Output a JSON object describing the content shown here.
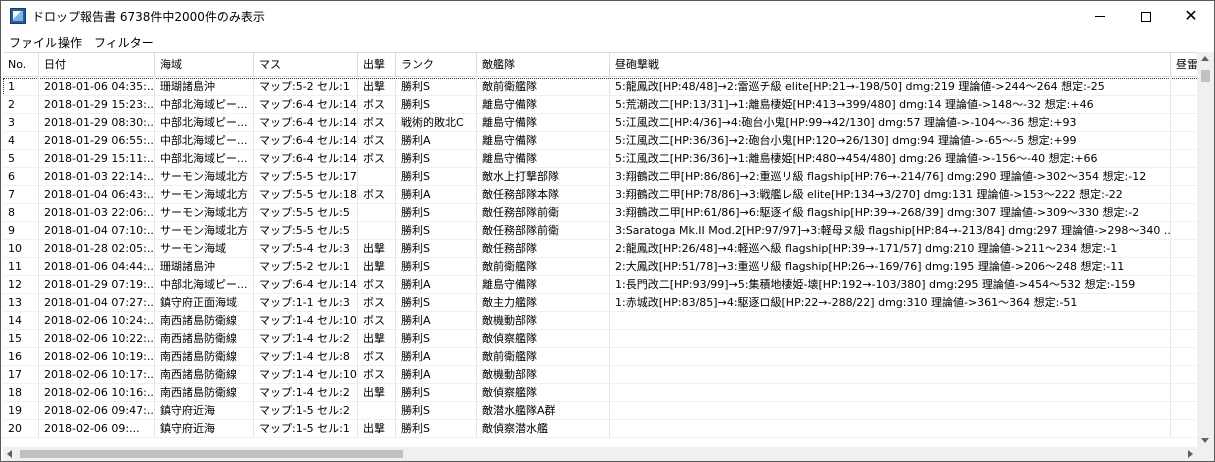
{
  "window": {
    "title": "ドロップ報告書 6738件中2000件のみ表示",
    "minimize_icon": "minimize-icon",
    "maximize_icon": "maximize-icon",
    "close_icon": "close-icon"
  },
  "menu": {
    "items": [
      "ファイル",
      "操作",
      "フィルター"
    ]
  },
  "table": {
    "columns": [
      "No.",
      "日付",
      "海域",
      "マス",
      "出撃",
      "ランク",
      "敵艦隊",
      "昼砲撃戦",
      "昼雷"
    ],
    "selected_row": 0,
    "rows": [
      [
        "1",
        "2018-01-06 04:35:...",
        "珊瑚諸島沖",
        "マップ:5-2 セル:1",
        "出撃",
        "勝利S",
        "敵前衛艦隊",
        "5:龍鳳改[HP:48/48]→2:雷巡チ級 elite[HP:21→-198/50] dmg:219 理論値->244～264 想定:-25"
      ],
      [
        "2",
        "2018-01-29 15:23:...",
        "中部北海域ピー...",
        "マップ:6-4 セル:14",
        "ボス",
        "勝利S",
        "離島守備隊",
        "5:荒潮改二[HP:13/31]→1:離島棲姫[HP:413→399/480] dmg:14 理論値->148～-32 想定:+46"
      ],
      [
        "3",
        "2018-01-29 08:30:...",
        "中部北海域ピー...",
        "マップ:6-4 セル:14",
        "ボス",
        "戦術的敗北C",
        "離島守備隊",
        "5:江風改二[HP:4/36]→4:砲台小鬼[HP:99→42/130] dmg:57 理論値->-104～-36 想定:+93"
      ],
      [
        "4",
        "2018-01-29 06:55:...",
        "中部北海域ピー...",
        "マップ:6-4 セル:14",
        "ボス",
        "勝利A",
        "離島守備隊",
        "5:江風改二[HP:36/36]→2:砲台小鬼[HP:120→26/130] dmg:94 理論値->-65～-5 想定:+99"
      ],
      [
        "5",
        "2018-01-29 15:11:...",
        "中部北海域ピー...",
        "マップ:6-4 セル:14",
        "ボス",
        "勝利S",
        "離島守備隊",
        "5:江風改二[HP:36/36]→1:離島棲姫[HP:480→454/480] dmg:26 理論値->-156～-40 想定:+66"
      ],
      [
        "6",
        "2018-01-03 22:14:...",
        "サーモン海域北方",
        "マップ:5-5 セル:17",
        "",
        "勝利S",
        "敵水上打撃部隊",
        "3:翔鶴改二甲[HP:86/86]→2:重巡リ級 flagship[HP:76→-214/76] dmg:290 理論値->302～354 想定:-12"
      ],
      [
        "7",
        "2018-01-04 06:43:...",
        "サーモン海域北方",
        "マップ:5-5 セル:18",
        "ボス",
        "勝利A",
        "敵任務部隊本隊",
        "3:翔鶴改二甲[HP:78/86]→3:戦艦レ級 elite[HP:134→3/270] dmg:131 理論値->153～222 想定:-22"
      ],
      [
        "8",
        "2018-01-03 22:06:...",
        "サーモン海域北方",
        "マップ:5-5 セル:5",
        "",
        "勝利S",
        "敵任務部隊前衛",
        "3:翔鶴改二甲[HP:61/86]→6:駆逐イ級 flagship[HP:39→-268/39] dmg:307 理論値->309～330 想定:-2"
      ],
      [
        "9",
        "2018-01-04 07:10:...",
        "サーモン海域北方",
        "マップ:5-5 セル:5",
        "",
        "勝利S",
        "敵任務部隊前衛",
        "3:Saratoga Mk.II Mod.2[HP:97/97]→3:軽母ヌ級 flagship[HP:84→-213/84] dmg:297 理論値->298～340 ..."
      ],
      [
        "10",
        "2018-01-28 02:05:...",
        "サーモン海域",
        "マップ:5-4 セル:3",
        "出撃",
        "勝利S",
        "敵任務部隊",
        "2:龍鳳改[HP:26/48]→4:軽巡ヘ級 flagship[HP:39→-171/57] dmg:210 理論値->211～234 想定:-1"
      ],
      [
        "11",
        "2018-01-06 04:44:...",
        "珊瑚諸島沖",
        "マップ:5-2 セル:1",
        "出撃",
        "勝利S",
        "敵前衛艦隊",
        "2:大鳳改[HP:51/78]→3:重巡リ級 flagship[HP:26→-169/76] dmg:195 理論値->206～248 想定:-11"
      ],
      [
        "12",
        "2018-01-29 07:19:...",
        "中部北海域ピー...",
        "マップ:6-4 セル:14",
        "ボス",
        "勝利A",
        "離島守備隊",
        "1:長門改二[HP:93/99]→5:集積地棲姫-壊[HP:192→-103/380] dmg:295 理論値->454～532 想定:-159"
      ],
      [
        "13",
        "2018-01-04 07:27:...",
        "鎮守府正面海域",
        "マップ:1-1 セル:3",
        "ボス",
        "勝利S",
        "敵主力艦隊",
        "1:赤城改[HP:83/85]→4:駆逐ロ級[HP:22→-288/22] dmg:310 理論値->361～364 想定:-51"
      ],
      [
        "14",
        "2018-02-06 10:24:...",
        "南西諸島防衛線",
        "マップ:1-4 セル:10",
        "ボス",
        "勝利A",
        "敵機動部隊",
        ""
      ],
      [
        "15",
        "2018-02-06 10:22:...",
        "南西諸島防衛線",
        "マップ:1-4 セル:2",
        "出撃",
        "勝利S",
        "敵偵察艦隊",
        ""
      ],
      [
        "16",
        "2018-02-06 10:19:...",
        "南西諸島防衛線",
        "マップ:1-4 セル:8",
        "ボス",
        "勝利A",
        "敵前衛艦隊",
        ""
      ],
      [
        "17",
        "2018-02-06 10:17:...",
        "南西諸島防衛線",
        "マップ:1-4 セル:10",
        "ボス",
        "勝利A",
        "敵機動部隊",
        ""
      ],
      [
        "18",
        "2018-02-06 10:16:...",
        "南西諸島防衛線",
        "マップ:1-4 セル:2",
        "出撃",
        "勝利S",
        "敵偵察艦隊",
        ""
      ],
      [
        "19",
        "2018-02-06 09:47:...",
        "鎮守府近海",
        "マップ:1-5 セル:2",
        "",
        "勝利S",
        "敵潜水艦隊A群",
        ""
      ],
      [
        "20",
        "2018-02-06 09:...",
        "鎮守府近海",
        "マップ:1-5 セル:1",
        "出撃",
        "勝利S",
        "敵偵察潜水艦",
        ""
      ]
    ]
  }
}
